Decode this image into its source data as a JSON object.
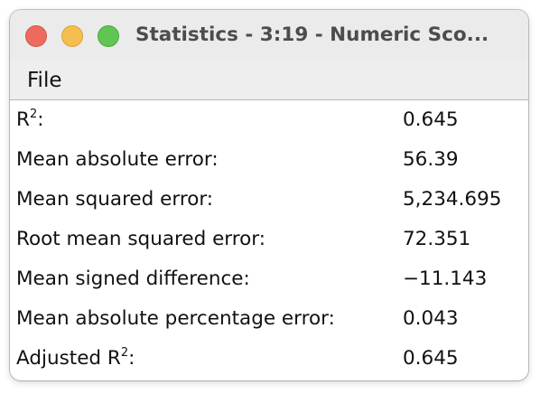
{
  "window": {
    "title": "Statistics - 3:19 - Numeric Sco..."
  },
  "menu": {
    "items": [
      "File"
    ]
  },
  "stats": [
    {
      "label_main": "R",
      "label_sup": "2",
      "label_suffix": ":",
      "value": "0.645"
    },
    {
      "label_main": "Mean absolute error:",
      "value": "56.39"
    },
    {
      "label_main": "Mean squared error:",
      "value": "5,234.695"
    },
    {
      "label_main": "Root mean squared error:",
      "value": "72.351"
    },
    {
      "label_main": "Mean signed difference:",
      "value": "−11.143"
    },
    {
      "label_main": "Mean absolute percentage error:",
      "value": "0.043"
    },
    {
      "label_main": "Adjusted R",
      "label_sup": "2",
      "label_suffix": ":",
      "value": "0.645"
    }
  ]
}
